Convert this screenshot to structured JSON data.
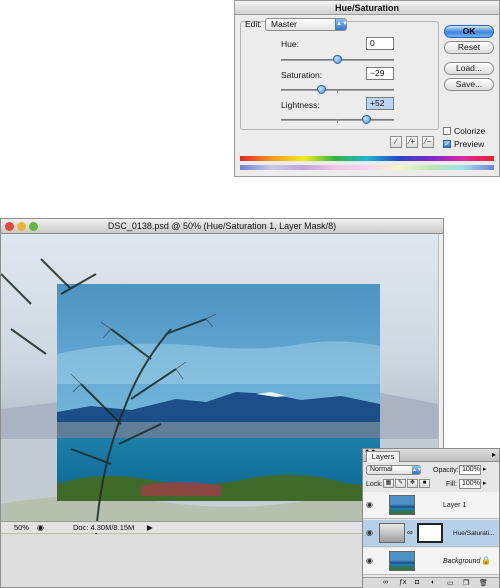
{
  "hue_saturation": {
    "title": "Hue/Saturation",
    "edit_label": "Edit:",
    "edit_value": "Master",
    "hue": {
      "label": "Hue:",
      "value": "0",
      "level": 0.5
    },
    "saturation": {
      "label": "Saturation:",
      "value": "−29",
      "level": 0.355
    },
    "lightness": {
      "label": "Lightness:",
      "value": "+52",
      "level": 0.76
    },
    "buttons": {
      "ok": "OK",
      "reset": "Reset",
      "load": "Load...",
      "save": "Save..."
    },
    "colorize_label": "Colorize",
    "colorize_checked": false,
    "preview_label": "Preview",
    "preview_checked": true,
    "eyedropper_icons": [
      "eyedropper-icon",
      "eyedropper-plus-icon",
      "eyedropper-minus-icon"
    ]
  },
  "document": {
    "title": "DSC_0138.psd @ 50% (Hue/Saturation 1, Layer Mask/8)",
    "zoom": "50%",
    "doc_size": "Doc: 4.30M/8.15M",
    "colors": {
      "close": "#e6453b",
      "minimize": "#f0b332",
      "zoom": "#5fb93d"
    }
  },
  "layers_panel": {
    "tab_label": "Layers",
    "blend_mode": "Normal",
    "opacity_label": "Opacity:",
    "opacity_value": "100%",
    "lock_label": "Lock:",
    "fill_label": "Fill:",
    "fill_value": "100%",
    "layers": [
      {
        "name": "Layer 1",
        "active": false
      },
      {
        "name": "Hue/Saturati...",
        "active": true
      },
      {
        "name": "Background",
        "active": false
      }
    ]
  }
}
